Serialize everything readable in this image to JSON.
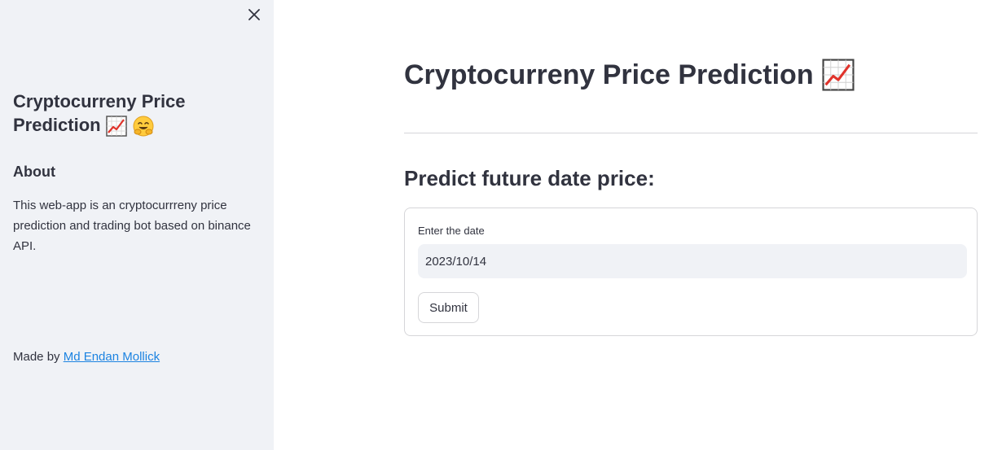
{
  "sidebar": {
    "title": "Cryptocurreny Price Prediction",
    "about_heading": "About",
    "description": "This web-app is an cryptocurrreny price prediction and trading bot based on binance API.",
    "made_by_prefix": "Made by ",
    "author_link": "Md Endan Mollick",
    "icons": [
      "chart-increasing-icon",
      "hugging-face-icon",
      "close-icon"
    ]
  },
  "main": {
    "title": "Cryptocurreny Price Prediction",
    "subtitle": "Predict future date price:",
    "form": {
      "date_label": "Enter the date",
      "date_value": "2023/10/14",
      "submit_label": "Submit"
    }
  },
  "colors": {
    "sidebar_bg": "#f0f2f6",
    "text": "#31333f",
    "link": "#1c83e1",
    "border": "#d6d6d9"
  }
}
